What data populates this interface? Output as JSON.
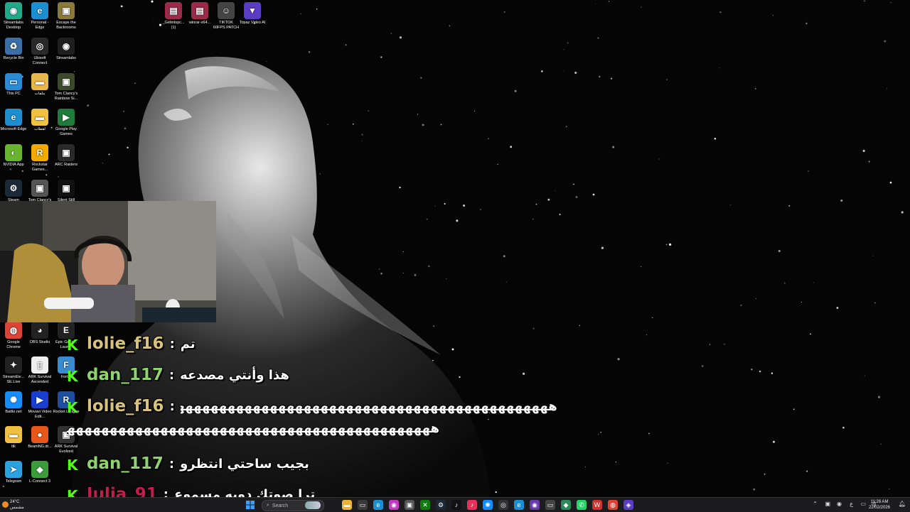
{
  "colors": {
    "kick_green": "#53fc18",
    "user_lolie": "#d7c27f",
    "user_dan": "#8ed36b",
    "user_julia": "#c21d4d"
  },
  "desktop_icons_col1": [
    {
      "label": "Streamlabs Desktop",
      "icon": "streamlabs-icon",
      "color": "#21a98a",
      "glyph": "◉"
    },
    {
      "label": "Recycle Bin",
      "icon": "recycle-bin-icon",
      "color": "#3a6fa8",
      "glyph": "♻"
    },
    {
      "label": "This PC",
      "icon": "monitor-icon",
      "color": "#2b8ad6",
      "glyph": "▭"
    },
    {
      "label": "Microsoft Edge",
      "icon": "edge-icon",
      "color": "#1d8fd1",
      "glyph": "e"
    },
    {
      "label": "NVIDIA App",
      "icon": "nvidia-icon",
      "color": "#6ab42d",
      "glyph": "◐"
    },
    {
      "label": "Steam",
      "icon": "steam-icon",
      "color": "#1b2838",
      "glyph": "⚙"
    }
  ],
  "desktop_icons_col2": [
    {
      "label": "Personal - Edge",
      "icon": "edge-profile-icon",
      "color": "#1d8fd1",
      "glyph": "e"
    },
    {
      "label": "Ubisoft Connect",
      "icon": "ubisoft-icon",
      "color": "#2a2a2a",
      "glyph": "◎"
    },
    {
      "label": "ملفات",
      "icon": "folder-icon",
      "color": "#e6b84a",
      "glyph": "▬"
    },
    {
      "label": "لقطات",
      "icon": "folder-icon",
      "color": "#f0c040",
      "glyph": "▬"
    },
    {
      "label": "Rockstar Games...",
      "icon": "rockstar-icon",
      "color": "#f2a900",
      "glyph": "R"
    },
    {
      "label": "Tom Clancy's",
      "icon": "game-icon",
      "color": "#555",
      "glyph": "▣"
    }
  ],
  "desktop_icons_col3": [
    {
      "label": "Escape the Backrooms",
      "icon": "game-icon",
      "color": "#8a7a3a",
      "glyph": "▣"
    },
    {
      "label": "Streamlabs",
      "icon": "streamlabs-icon",
      "color": "#1f1f1f",
      "glyph": "◉"
    },
    {
      "label": "Tom Clancy's Rainbow Si...",
      "icon": "game-icon",
      "color": "#3d4a2a",
      "glyph": "▣"
    },
    {
      "label": "Google Play Games",
      "icon": "play-games-icon",
      "color": "#1e7d3a",
      "glyph": "▶"
    },
    {
      "label": "ARC Raiders",
      "icon": "game-icon",
      "color": "#2a2a2a",
      "glyph": "▣"
    },
    {
      "label": "Silent Still",
      "icon": "game-icon",
      "color": "#111",
      "glyph": "▣"
    }
  ],
  "desktop_icons_top": [
    {
      "label": "_Getintopc... (1)",
      "icon": "winrar-icon",
      "color": "#9c2b4a",
      "glyph": "▤"
    },
    {
      "label": "winrar-x64...",
      "icon": "winrar-icon",
      "color": "#9c2b4a",
      "glyph": "▤"
    },
    {
      "label": "TIKTOK 60FPS PATCH",
      "icon": "app-icon",
      "color": "#444",
      "glyph": "☺"
    },
    {
      "label": "Topaz Video AI",
      "icon": "topaz-icon",
      "color": "#5b3cc4",
      "glyph": "▼"
    }
  ],
  "desktop_icons_lower_col1": [
    {
      "label": "Google Chrome",
      "icon": "chrome-icon",
      "color": "#db4437",
      "glyph": "◍"
    },
    {
      "label": "StreamEle... SE.Live",
      "icon": "streamelements-icon",
      "color": "#222",
      "glyph": "✦"
    },
    {
      "label": "Battle.net",
      "icon": "battlenet-icon",
      "color": "#148eff",
      "glyph": "✺"
    },
    {
      "label": "ttk",
      "icon": "folder-icon",
      "color": "#f0c040",
      "glyph": "▬"
    },
    {
      "label": "Telegram",
      "icon": "telegram-icon",
      "color": "#2aa3e0",
      "glyph": "➤"
    }
  ],
  "desktop_icons_lower_col2": [
    {
      "label": "OBS Studio",
      "icon": "obs-icon",
      "color": "#222",
      "glyph": "◕"
    },
    {
      "label": "ARK Survival Ascended",
      "icon": "file-icon",
      "color": "#eee",
      "glyph": "▯"
    },
    {
      "label": "Movavi Video Edit...",
      "icon": "movavi-icon",
      "color": "#1a3fd0",
      "glyph": "▶"
    },
    {
      "label": "BeamNG.dr...",
      "icon": "beamng-icon",
      "color": "#e8561a",
      "glyph": "●"
    },
    {
      "label": "L-Connect 3",
      "icon": "lconnect-icon",
      "color": "#3a9d3a",
      "glyph": "◆"
    }
  ],
  "desktop_icons_lower_col3": [
    {
      "label": "Epic Games Laun...",
      "icon": "epic-icon",
      "color": "#222",
      "glyph": "E"
    },
    {
      "label": "Fort...",
      "icon": "fortnite-icon",
      "color": "#3a8ad0",
      "glyph": "F"
    },
    {
      "label": "Rocket League",
      "icon": "rocket-league-icon",
      "color": "#1d4fa0",
      "glyph": "R"
    },
    {
      "label": "ARK Survival Evolved",
      "icon": "game-icon",
      "color": "#333",
      "glyph": "▣"
    }
  ],
  "chat": [
    {
      "badge": "K",
      "user": "lolie_f16",
      "sep": ":",
      "msg": "تم",
      "color_key": "user_lolie"
    },
    {
      "badge": "K",
      "user": "dan_117",
      "sep": ":",
      "msg": "هذا وأنتي مصدعه",
      "color_key": "user_dan"
    },
    {
      "badge": "K",
      "user": "lolie_f16",
      "sep": ":",
      "msg": "هههههههههههههههههههههههههههههههههههههههههههههههههههههه",
      "color_key": "user_lolie"
    },
    {
      "badge": "K",
      "user": "dan_117",
      "sep": ":",
      "msg": "بجيب ساحتي انتظرو",
      "color_key": "user_dan"
    },
    {
      "badge": "K",
      "user": "Julia_91",
      "sep": ":",
      "msg": "ترا صوتك دوبه مسموع",
      "color_key": "user_julia"
    }
  ],
  "chat_wrap_text": "هههههههههههههههههههههههههههههههههههههههههههههههههههههههههههههه",
  "taskbar": {
    "weather_temp": "24°C",
    "weather_desc": "مشمس",
    "search_placeholder": "Search",
    "time": "11:26 AM",
    "date": "22/02/2026"
  },
  "taskbar_apps": [
    {
      "name": "taskbar-file-explorer-icon",
      "color": "#e8b43a",
      "glyph": "▬"
    },
    {
      "name": "taskbar-app-icon",
      "color": "#3a3a3a",
      "glyph": "▭"
    },
    {
      "name": "taskbar-edge-icon",
      "color": "#1d8fd1",
      "glyph": "e"
    },
    {
      "name": "taskbar-app-icon",
      "color": "#c23ac2",
      "glyph": "◉"
    },
    {
      "name": "taskbar-store-icon",
      "color": "#555",
      "glyph": "▣"
    },
    {
      "name": "taskbar-xbox-icon",
      "color": "#107c10",
      "glyph": "✕"
    },
    {
      "name": "taskbar-steam-icon",
      "color": "#1b2838",
      "glyph": "⚙"
    },
    {
      "name": "taskbar-tiktok-icon",
      "color": "#111",
      "glyph": "♪"
    },
    {
      "name": "taskbar-tiktok-live-icon",
      "color": "#e8315a",
      "glyph": "♪"
    },
    {
      "name": "taskbar-battlenet-icon",
      "color": "#148eff",
      "glyph": "✺"
    },
    {
      "name": "taskbar-app-icon",
      "color": "#333",
      "glyph": "◎"
    },
    {
      "name": "taskbar-edge-icon",
      "color": "#1d8fd1",
      "glyph": "e"
    },
    {
      "name": "taskbar-app-icon",
      "color": "#6a3aa8",
      "glyph": "◉"
    },
    {
      "name": "taskbar-app-icon",
      "color": "#444",
      "glyph": "▭"
    },
    {
      "name": "taskbar-app-icon",
      "color": "#2a8a5a",
      "glyph": "◆"
    },
    {
      "name": "taskbar-whatsapp-icon",
      "color": "#25d366",
      "glyph": "✆"
    },
    {
      "name": "taskbar-app-icon",
      "color": "#d03030",
      "glyph": "W"
    },
    {
      "name": "taskbar-chrome-icon",
      "color": "#db4437",
      "glyph": "◍"
    },
    {
      "name": "taskbar-app-icon",
      "color": "#5b3cc4",
      "glyph": "◈"
    }
  ]
}
